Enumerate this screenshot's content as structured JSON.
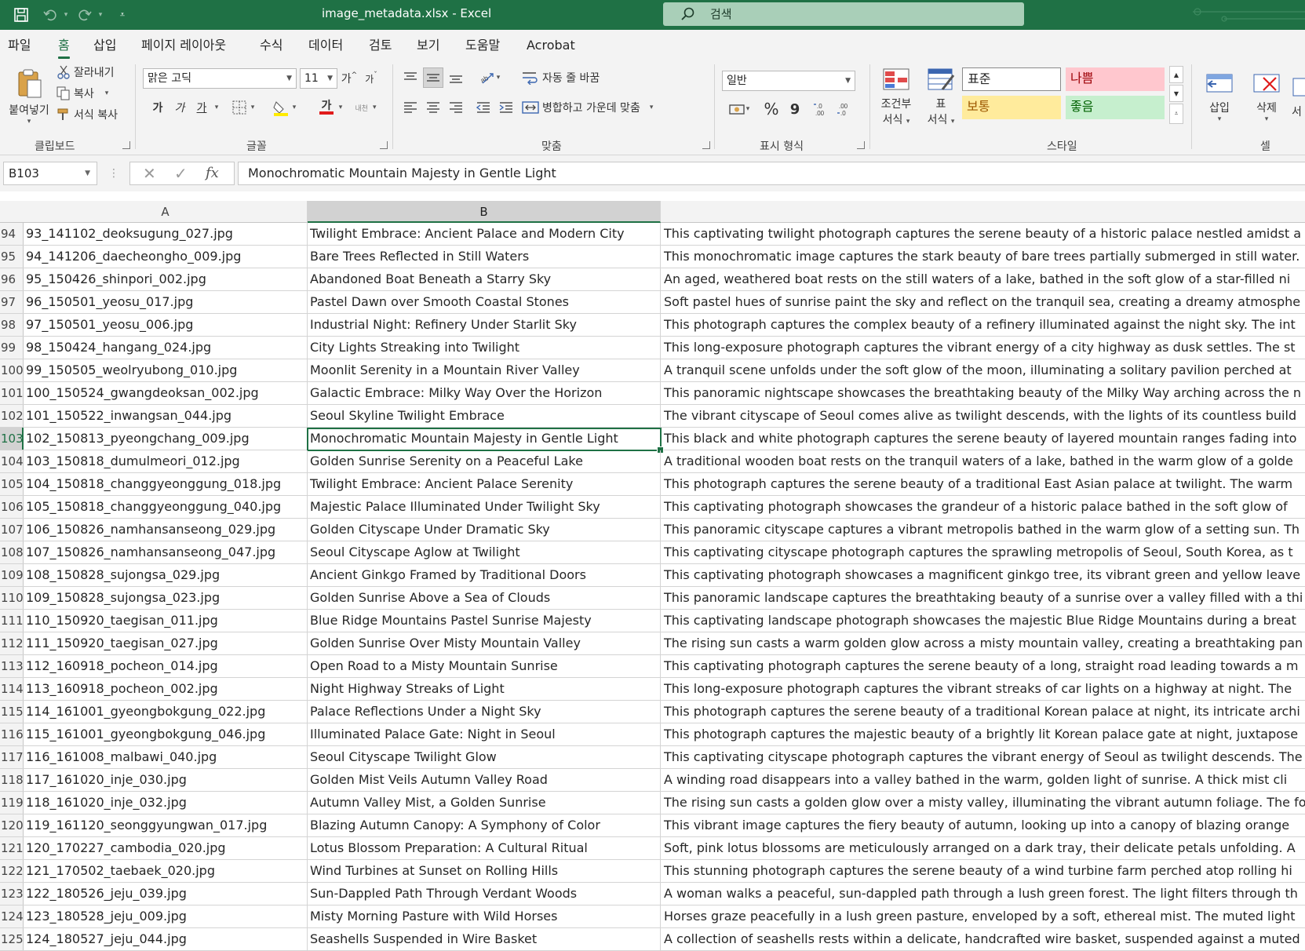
{
  "window": {
    "title": "image_metadata.xlsx  -  Excel",
    "search_placeholder": "검색"
  },
  "ribbon_tabs": [
    "파일",
    "홈",
    "삽입",
    "페이지 레이아웃",
    "수식",
    "데이터",
    "검토",
    "보기",
    "도움말",
    "Acrobat"
  ],
  "active_tab": "홈",
  "clipboard": {
    "paste_label": "붙여넣기",
    "cut_label": "잘라내기",
    "copy_label": "복사",
    "format_painter_label": "서식 복사",
    "group_label": "클립보드"
  },
  "font": {
    "font_name": "맑은 고딕",
    "font_size": "11",
    "grow_label": "가",
    "shrink_label": "가",
    "bold_label": "가",
    "italic_label": "가",
    "underline_label": "가",
    "font_color_label": "가",
    "phonetic_label": "내천",
    "group_label": "글꼴"
  },
  "alignment": {
    "wrap_text_label": "자동 줄 바꿈",
    "merge_center_label": "병합하고 가운데 맞춤",
    "group_label": "맞춤"
  },
  "number": {
    "format_value": "일반",
    "percent_label": "%",
    "comma_label": "9",
    "group_label": "표시 형식"
  },
  "styles": {
    "conditional_label_1": "조건부",
    "conditional_label_2": "서식",
    "table_label_1": "표",
    "table_label_2": "서식",
    "normal": "표준",
    "bad": "나쁨",
    "neutral": "보통",
    "good": "좋음",
    "group_label": "스타일"
  },
  "cells": {
    "insert_label": "삽입",
    "delete_label": "삭제",
    "format_label": "서",
    "group_label": "셀"
  },
  "colors": {
    "excel_green": "#1f7145",
    "bad_bg": "#ffc7ce",
    "bad_fg": "#9c0006",
    "neutral_bg": "#ffeb9c",
    "neutral_fg": "#9c5700",
    "good_bg": "#c6efce",
    "good_fg": "#006100"
  },
  "formula_bar": {
    "name_box": "B103",
    "cancel_icon": "✕",
    "enter_icon": "✓",
    "fx_label": "fx",
    "content": "Monochromatic Mountain Majesty in Gentle Light"
  },
  "columns": [
    "A",
    "B",
    ""
  ],
  "selected_column": "B",
  "selected_row": "103",
  "rows": [
    {
      "n": "94",
      "a": "93_141102_deoksugung_027.jpg",
      "b": "Twilight Embrace: Ancient Palace and Modern City",
      "c": "This captivating twilight photograph captures the serene beauty of a historic palace nestled amidst a"
    },
    {
      "n": "95",
      "a": "94_141206_daecheongho_009.jpg",
      "b": "Bare Trees Reflected in Still Waters",
      "c": "This monochromatic image captures the stark beauty of bare trees partially submerged in still water."
    },
    {
      "n": "96",
      "a": "95_150426_shinpori_002.jpg",
      "b": "Abandoned Boat Beneath a Starry Sky",
      "c": "An aged, weathered boat rests on the still waters of a lake, bathed in the soft glow of a star-filled ni"
    },
    {
      "n": "97",
      "a": "96_150501_yeosu_017.jpg",
      "b": "Pastel Dawn over Smooth Coastal Stones",
      "c": "Soft pastel hues of sunrise paint the sky and reflect on the tranquil sea, creating a dreamy atmosphe"
    },
    {
      "n": "98",
      "a": "97_150501_yeosu_006.jpg",
      "b": "Industrial Night: Refinery Under Starlit Sky",
      "c": "This photograph captures the complex beauty of a refinery illuminated against the night sky. The int"
    },
    {
      "n": "99",
      "a": "98_150424_hangang_024.jpg",
      "b": "City Lights Streaking into Twilight",
      "c": "This long-exposure photograph captures the vibrant energy of a city highway as dusk settles. The st"
    },
    {
      "n": "100",
      "a": "99_150505_weolryubong_010.jpg",
      "b": "Moonlit Serenity in a Mountain River Valley",
      "c": "A tranquil scene unfolds under the soft glow of the moon, illuminating a solitary pavilion perched at"
    },
    {
      "n": "101",
      "a": "100_150524_gwangdeoksan_002.jpg",
      "b": "Galactic Embrace: Milky Way Over the Horizon",
      "c": "This panoramic nightscape showcases the breathtaking beauty of the Milky Way arching across the n"
    },
    {
      "n": "102",
      "a": "101_150522_inwangsan_044.jpg",
      "b": "Seoul Skyline Twilight Embrace",
      "c": "The vibrant cityscape of Seoul comes alive as twilight descends, with the lights of its countless build"
    },
    {
      "n": "103",
      "a": "102_150813_pyeongchang_009.jpg",
      "b": "Monochromatic Mountain Majesty in Gentle Light",
      "c": "This black and white photograph captures the serene beauty of layered mountain ranges fading into"
    },
    {
      "n": "104",
      "a": "103_150818_dumulmeori_012.jpg",
      "b": "Golden Sunrise Serenity on a Peaceful Lake",
      "c": "A traditional wooden boat rests on the tranquil waters of a lake, bathed in the warm glow of a golde"
    },
    {
      "n": "105",
      "a": "104_150818_changgyeonggung_018.jpg",
      "b": "Twilight Embrace: Ancient Palace Serenity",
      "c": "This photograph captures the serene beauty of a traditional East Asian palace at twilight.  The warm"
    },
    {
      "n": "106",
      "a": "105_150818_changgyeonggung_040.jpg",
      "b": "Majestic Palace Illuminated Under Twilight Sky",
      "c": "This captivating photograph showcases the grandeur of a historic palace bathed in the soft glow of"
    },
    {
      "n": "107",
      "a": "106_150826_namhansanseong_029.jpg",
      "b": "Golden Cityscape Under Dramatic Sky",
      "c": "This panoramic cityscape captures a vibrant metropolis bathed in the warm glow of a setting sun. Th"
    },
    {
      "n": "108",
      "a": "107_150826_namhansanseong_047.jpg",
      "b": "Seoul Cityscape Aglow at Twilight",
      "c": "This captivating cityscape photograph captures the sprawling metropolis of Seoul, South Korea, as t"
    },
    {
      "n": "109",
      "a": "108_150828_sujongsa_029.jpg",
      "b": "Ancient Ginkgo Framed by Traditional Doors",
      "c": "This captivating photograph showcases a magnificent ginkgo tree, its vibrant green and yellow leave"
    },
    {
      "n": "110",
      "a": "109_150828_sujongsa_023.jpg",
      "b": "Golden Sunrise Above a Sea of Clouds",
      "c": "This panoramic landscape captures the breathtaking beauty of a sunrise over a valley filled with a thi"
    },
    {
      "n": "111",
      "a": "110_150920_taegisan_011.jpg",
      "b": "Blue Ridge Mountains Pastel Sunrise Majesty",
      "c": "This captivating landscape photograph showcases the majestic Blue Ridge Mountains during a breat"
    },
    {
      "n": "112",
      "a": "111_150920_taegisan_027.jpg",
      "b": "Golden Sunrise Over Misty Mountain Valley",
      "c": "The rising sun casts a warm golden glow across a misty mountain valley, creating a breathtaking pan"
    },
    {
      "n": "113",
      "a": "112_160918_pocheon_014.jpg",
      "b": "Open Road to a Misty Mountain Sunrise",
      "c": "This captivating photograph captures the serene beauty of a long, straight road leading towards a m"
    },
    {
      "n": "114",
      "a": "113_160918_pocheon_002.jpg",
      "b": "Night Highway Streaks of Light",
      "c": "This long-exposure photograph captures the vibrant streaks of car lights on a highway at night. The"
    },
    {
      "n": "115",
      "a": "114_161001_gyeongbokgung_022.jpg",
      "b": "Palace Reflections Under a Night Sky",
      "c": "This photograph captures the serene beauty of a traditional Korean palace at night, its intricate archi"
    },
    {
      "n": "116",
      "a": "115_161001_gyeongbokgung_046.jpg",
      "b": "Illuminated Palace Gate: Night in Seoul",
      "c": "This photograph captures the majestic beauty of a brightly lit Korean palace gate at night, juxtapose"
    },
    {
      "n": "117",
      "a": "116_161008_malbawi_040.jpg",
      "b": "Seoul Cityscape Twilight Glow",
      "c": "This captivating cityscape photograph captures the vibrant energy of Seoul as twilight descends. The"
    },
    {
      "n": "118",
      "a": "117_161020_inje_030.jpg",
      "b": "Golden Mist Veils Autumn Valley Road",
      "c": "A winding road disappears into a valley bathed in the warm, golden light of sunrise.  A thick mist cli"
    },
    {
      "n": "119",
      "a": "118_161020_inje_032.jpg",
      "b": "Autumn Valley Mist, a Golden Sunrise",
      "c": "The rising sun casts a golden glow over a misty valley, illuminating the vibrant autumn foliage. The fo"
    },
    {
      "n": "120",
      "a": "119_161120_seonggyungwan_017.jpg",
      "b": "Blazing Autumn Canopy: A Symphony of Color",
      "c": "This vibrant image captures the fiery beauty of autumn, looking up into a canopy of blazing orange"
    },
    {
      "n": "121",
      "a": "120_170227_cambodia_020.jpg",
      "b": "Lotus Blossom Preparation: A Cultural Ritual",
      "c": "Soft, pink lotus blossoms are meticulously arranged on a dark tray, their delicate petals unfolding.  A"
    },
    {
      "n": "122",
      "a": "121_170502_taebaek_020.jpg",
      "b": "Wind Turbines at Sunset on Rolling Hills",
      "c": "This stunning photograph captures the serene beauty of a wind turbine farm perched atop rolling hi"
    },
    {
      "n": "123",
      "a": "122_180526_jeju_039.jpg",
      "b": "Sun-Dappled Path Through Verdant Woods",
      "c": "A woman walks a peaceful, sun-dappled path through a lush green forest. The light filters through th"
    },
    {
      "n": "124",
      "a": "123_180528_jeju_009.jpg",
      "b": "Misty Morning Pasture with Wild Horses",
      "c": "Horses graze peacefully in a lush green pasture, enveloped by a soft, ethereal mist. The muted light"
    },
    {
      "n": "125",
      "a": "124_180527_jeju_044.jpg",
      "b": "Seashells Suspended in Wire Basket",
      "c": "A collection of seashells rests within a delicate, handcrafted wire basket, suspended against a muted"
    }
  ]
}
